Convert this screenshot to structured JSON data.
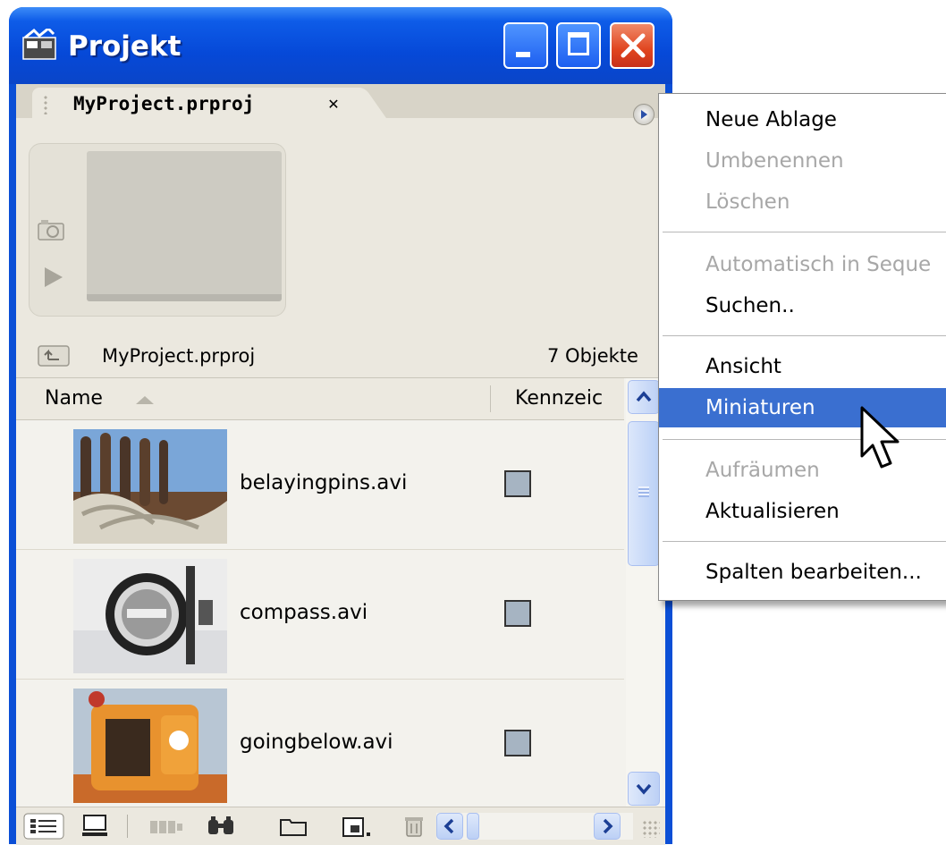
{
  "window": {
    "title": "Projekt"
  },
  "tab": {
    "label": "MyProject.prproj",
    "close_glyph": "✕"
  },
  "preview": {
    "project_name": "MyProject.prproj",
    "object_count": "7 Objekte"
  },
  "list": {
    "columns": [
      "Name",
      "Kennzeic"
    ],
    "rows": [
      {
        "name": "belayingpins.avi",
        "label_color": "#a6b4c2"
      },
      {
        "name": "compass.avi",
        "label_color": "#a6b4c2"
      },
      {
        "name": "goingbelow.avi",
        "label_color": "#a6b4c2"
      }
    ]
  },
  "context_menu": {
    "items": [
      {
        "label": "Neue Ablage",
        "enabled": true
      },
      {
        "label": "Umbenennen",
        "enabled": false
      },
      {
        "label": "Löschen",
        "enabled": false
      },
      {
        "label": "Automatisch in Seque",
        "enabled": false
      },
      {
        "label": "Suchen..",
        "enabled": true
      },
      {
        "label": "Ansicht",
        "enabled": true
      },
      {
        "label": "Miniaturen",
        "enabled": true,
        "highlighted": true
      },
      {
        "label": "Aufräumen",
        "enabled": false
      },
      {
        "label": "Aktualisieren",
        "enabled": true
      },
      {
        "label": "Spalten bearbeiten...",
        "enabled": true
      }
    ]
  },
  "toolbar_icons": [
    "list-view-icon",
    "icon-view-icon",
    "automate-to-sequence-icon",
    "find-icon",
    "new-bin-icon",
    "new-item-icon",
    "delete-icon"
  ],
  "colors": {
    "titlebar": "#0649d8",
    "highlight": "#3a6fd0",
    "panel": "#ebe8df"
  }
}
